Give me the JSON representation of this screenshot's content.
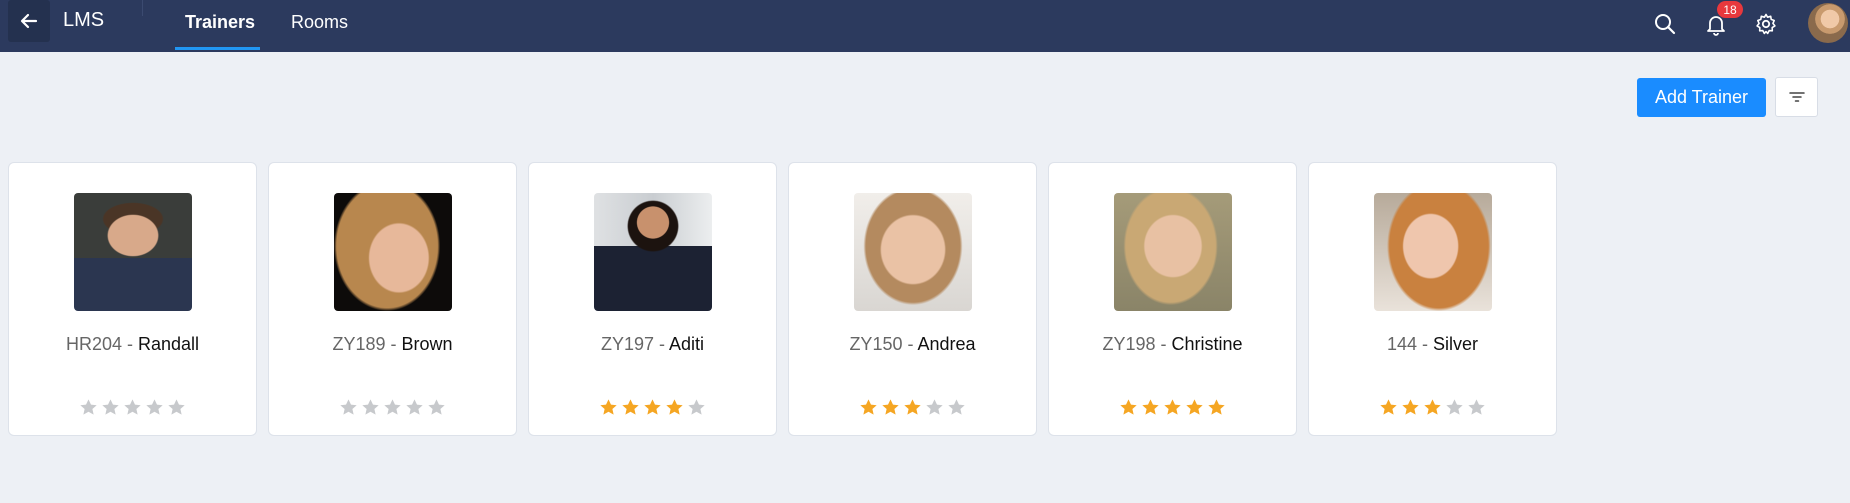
{
  "header": {
    "app_title": "LMS",
    "tabs": [
      {
        "label": "Trainers",
        "active": true
      },
      {
        "label": "Rooms",
        "active": false
      }
    ],
    "notification_count": "18",
    "icons": [
      "back-arrow-icon",
      "search-icon",
      "bell-icon",
      "gear-icon"
    ]
  },
  "actions": {
    "add_trainer_label": "Add Trainer",
    "filter_icon": "filter-icon"
  },
  "colors": {
    "topbar": "#2c3a5e",
    "accent": "#1a8cff",
    "star_on": "#f5a623",
    "star_off": "#c7c9cc"
  },
  "trainers": [
    {
      "code": "HR204",
      "separator": " - ",
      "name": "Randall",
      "rating": 0
    },
    {
      "code": "ZY189",
      "separator": " - ",
      "name": "Brown",
      "rating": 0
    },
    {
      "code": "ZY197",
      "separator": " - ",
      "name": "Aditi",
      "rating": 4
    },
    {
      "code": "ZY150",
      "separator": " - ",
      "name": "Andrea",
      "rating": 3
    },
    {
      "code": "ZY198",
      "separator": " - ",
      "name": "Christine",
      "rating": 5
    },
    {
      "code": "144",
      "separator": " - ",
      "name": "Silver",
      "rating": 3
    }
  ]
}
